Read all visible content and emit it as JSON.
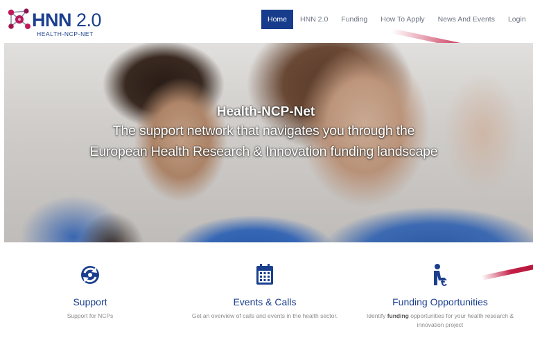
{
  "logo": {
    "title_main": "HNN",
    "title_version": "2.0",
    "subtitle": "HEALTH-NCP-NET"
  },
  "nav": {
    "items": [
      {
        "label": "Home",
        "active": true
      },
      {
        "label": "HNN 2.0",
        "active": false
      },
      {
        "label": "Funding",
        "active": false
      },
      {
        "label": "How To Apply",
        "active": false
      },
      {
        "label": "News And Events",
        "active": false
      },
      {
        "label": "Login",
        "active": false
      }
    ]
  },
  "hero": {
    "title": "Health-NCP-Net",
    "line1": "The support network that navigates you through the",
    "line2": "European Health Research & Innovation funding landscape"
  },
  "features": [
    {
      "icon": "sync-icon",
      "title": "Support",
      "desc": "Support for NCPs"
    },
    {
      "icon": "calendar-icon",
      "title": "Events & Calls",
      "desc": "Get an overview of calls and events in the health sector."
    },
    {
      "icon": "person-euro-icon",
      "title": "Funding Opportunities",
      "desc_pre": "Identify ",
      "desc_bold": "funding",
      "desc_post": " opportunities for your health research & innovation project"
    }
  ],
  "colors": {
    "brand_blue": "#1b3f8f",
    "nav_active": "#173c8c",
    "accent_red": "#c31e45",
    "logo_magenta": "#b3195a"
  }
}
